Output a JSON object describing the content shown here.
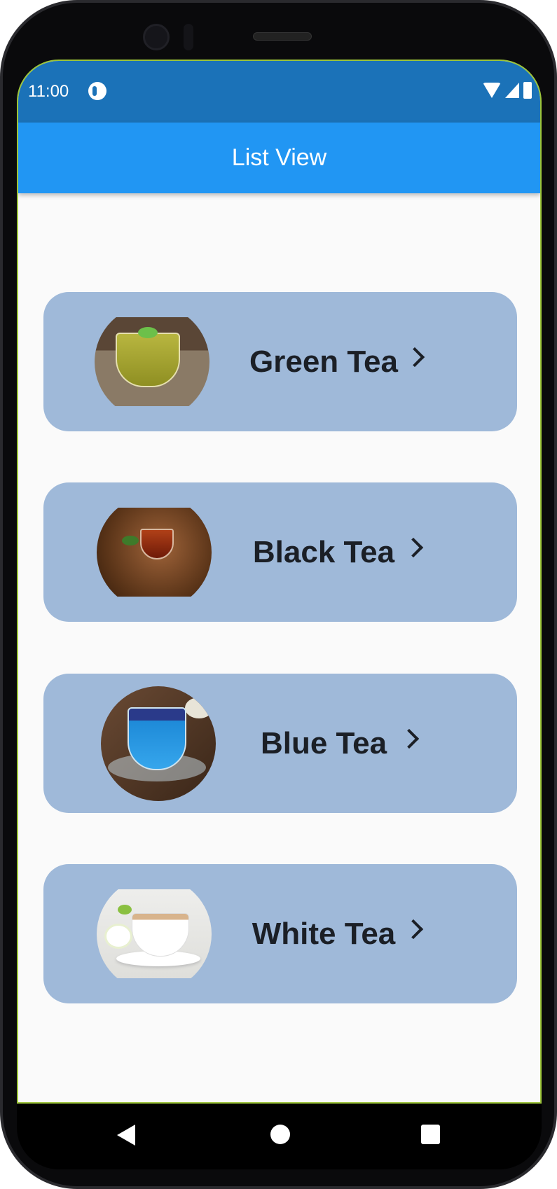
{
  "status_bar": {
    "time": "11:00",
    "icons": [
      "app-notification-icon",
      "wifi-icon",
      "signal-icon",
      "battery-icon"
    ]
  },
  "app_bar": {
    "title": "List View",
    "color": "#2196f3"
  },
  "list": {
    "card_color": "#9fb9d9",
    "items": [
      {
        "label": "Green Tea",
        "image": "green-tea-image",
        "icon": "chevron-right-icon"
      },
      {
        "label": "Black Tea",
        "image": "black-tea-image",
        "icon": "chevron-right-icon"
      },
      {
        "label": "Blue Tea",
        "image": "blue-tea-image",
        "icon": "chevron-right-icon"
      },
      {
        "label": "White Tea",
        "image": "white-tea-image",
        "icon": "chevron-right-icon"
      }
    ]
  },
  "nav_bar": {
    "buttons": [
      "back-icon",
      "home-icon",
      "recents-icon"
    ]
  }
}
